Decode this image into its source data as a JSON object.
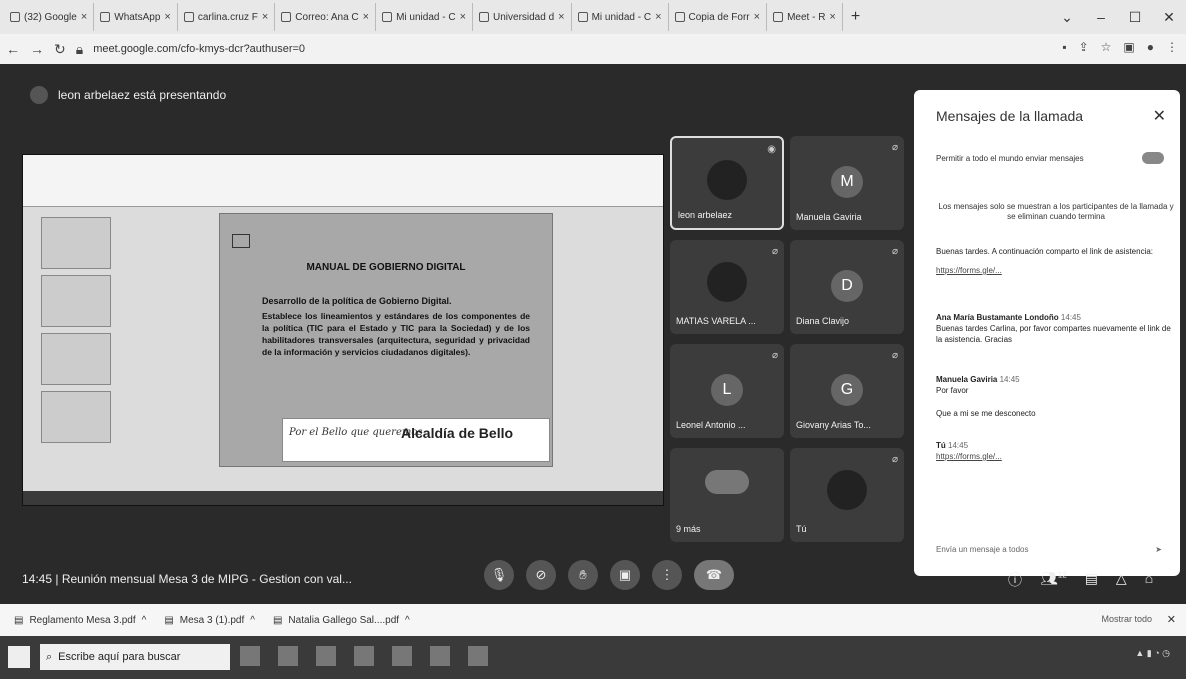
{
  "browser": {
    "tabs": [
      {
        "label": "(32) Google"
      },
      {
        "label": "WhatsApp"
      },
      {
        "label": "carlina.cruz F"
      },
      {
        "label": "Correo: Ana C"
      },
      {
        "label": "Mi unidad - C"
      },
      {
        "label": "Universidad d"
      },
      {
        "label": "Mi unidad - C"
      },
      {
        "label": "Copia de Forr"
      },
      {
        "label": "Meet - R"
      }
    ],
    "new_tab": "+",
    "url": "meet.google.com/cfo-kmys-dcr?authuser=0"
  },
  "meet": {
    "presenting_text": "leon arbelaez está presentando",
    "slide": {
      "title": "MANUAL DE GOBIERNO DIGITAL",
      "subtitle": "Desarrollo de la política de Gobierno Digital.",
      "body": "Establece los lineamientos y estándares de los componentes de la política (TIC para el Estado y TIC para la Sociedad) y de los habilitadores transversales (arquitectura, seguridad y privacidad de la información y servicios ciudadanos digitales).",
      "slogan": "Por el Bello que queremos",
      "alcaldia": "Alcaldía de Bello"
    },
    "participants": [
      {
        "name": "leon arbelaez"
      },
      {
        "name": "Manuela Gaviria",
        "letter": "M"
      },
      {
        "name": "MATIAS VARELA ..."
      },
      {
        "name": "Diana Clavijo",
        "letter": "D"
      },
      {
        "name": "Leonel Antonio ...",
        "letter": "L"
      },
      {
        "name": "Giovany Arias To...",
        "letter": "G"
      },
      {
        "name": "9 más"
      },
      {
        "name": "Tú"
      }
    ],
    "meeting_info": "14:45 | Reunión mensual Mesa 3 de MIPG - Gestion con val...",
    "participant_count": "12"
  },
  "chat": {
    "title": "Mensajes de la llamada",
    "permission": "Permitir a todo el mundo enviar mensajes",
    "note": "Los mensajes solo se muestran a los participantes de la llamada y se eliminan cuando termina",
    "messages": [
      {
        "text": "Buenas tardes. A continuación comparto el link de asistencia:",
        "link": "https://forms.gle/..."
      },
      {
        "who": "Ana María Bustamante Londoño",
        "time": "14:45",
        "text": "Buenas tardes Carlina, por favor compartes nuevamente el link de la asistencia. Gracias"
      },
      {
        "who": "Manuela Gaviria",
        "time": "14:45",
        "text": "Por favor"
      },
      {
        "text": "Que a mi se me desconecto"
      },
      {
        "who": "Tú",
        "time": "14:45",
        "link": "https://forms.gle/..."
      }
    ],
    "input_placeholder": "Envía un mensaje a todos"
  },
  "downloads": {
    "items": [
      "Reglamento Mesa 3.pdf",
      "Mesa 3 (1).pdf",
      "Natalia Gallego Sal....pdf"
    ],
    "show_all": "Mostrar todo"
  },
  "taskbar": {
    "search_placeholder": "Escribe aquí para buscar"
  }
}
